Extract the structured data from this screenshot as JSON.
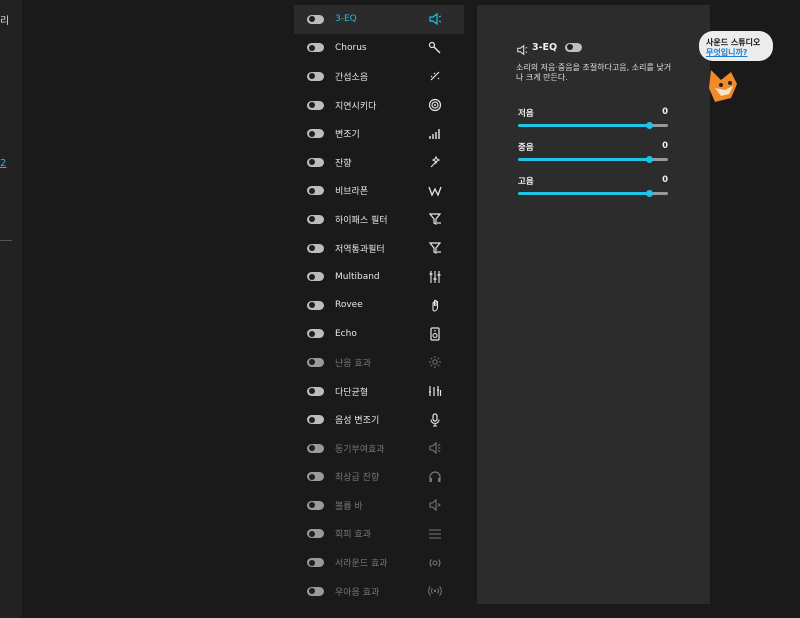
{
  "left_strip": {
    "top_text": "리",
    "link_text": "2"
  },
  "effects": [
    {
      "label": "3-EQ",
      "icon": "speaker-icon",
      "active": true,
      "dim": false
    },
    {
      "label": "Chorus",
      "icon": "wand-icon",
      "active": false,
      "dim": false
    },
    {
      "label": "간섭소음",
      "icon": "sparkle-icon",
      "active": false,
      "dim": false
    },
    {
      "label": "지연시키다",
      "icon": "spiral-icon",
      "active": false,
      "dim": false
    },
    {
      "label": "변조기",
      "icon": "signal-bars-icon",
      "active": false,
      "dim": false
    },
    {
      "label": "잔향",
      "icon": "magic-icon",
      "active": false,
      "dim": false
    },
    {
      "label": "비브라폰",
      "icon": "w-icon",
      "active": false,
      "dim": false
    },
    {
      "label": "하이패스 필터",
      "icon": "funnel-icon",
      "active": false,
      "dim": false
    },
    {
      "label": "저역통과필터",
      "icon": "funnel-icon",
      "active": false,
      "dim": false
    },
    {
      "label": "Multiband",
      "icon": "mixer-icon",
      "active": false,
      "dim": false
    },
    {
      "label": "Rovee",
      "icon": "hand-icon",
      "active": false,
      "dim": false
    },
    {
      "label": "Echo",
      "icon": "speaker-box-icon",
      "active": false,
      "dim": false
    },
    {
      "label": "난음 효과",
      "icon": "sun-icon",
      "active": false,
      "dim": true
    },
    {
      "label": "다단균형",
      "icon": "equalizer-icon",
      "active": false,
      "dim": false
    },
    {
      "label": "음성 변조기",
      "icon": "microphone-icon",
      "active": false,
      "dim": false
    },
    {
      "label": "동기부여효과",
      "icon": "speaker-waves-icon",
      "active": false,
      "dim": true
    },
    {
      "label": "최상급 잔향",
      "icon": "headphones-icon",
      "active": false,
      "dim": true
    },
    {
      "label": "볼륨 바",
      "icon": "volume-icon",
      "active": false,
      "dim": true
    },
    {
      "label": "회피 효과",
      "icon": "lines-icon",
      "active": false,
      "dim": true
    },
    {
      "label": "서라운드 효과",
      "icon": "surround-icon",
      "active": false,
      "dim": true
    },
    {
      "label": "우아음 효과",
      "icon": "broadcast-icon",
      "active": false,
      "dim": true
    }
  ],
  "panel": {
    "title": "3-EQ",
    "description": "소리의 저음·중음을 조절하다고음, 소리를 낮거나 크게 만든다.",
    "sliders": [
      {
        "label": "저음",
        "value": "0",
        "level": 0.87
      },
      {
        "label": "중음",
        "value": "0",
        "level": 0.87
      },
      {
        "label": "고음",
        "value": "0",
        "level": 0.87
      }
    ]
  },
  "bubble": {
    "line1": "사운드 스튜디오",
    "line2": "무엇입니까?"
  },
  "colors": {
    "accent": "#1ec3e6",
    "background": "#1a1a1a",
    "panel": "#2c2c2c"
  }
}
